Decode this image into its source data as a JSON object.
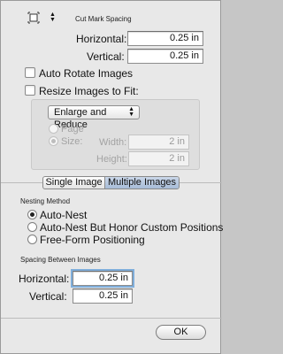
{
  "cut_mark": {
    "title": "Cut Mark Spacing",
    "icon": "crop-marks-icon",
    "horizontal_label": "Horizontal:",
    "horizontal_value": "0.25 in",
    "vertical_label": "Vertical:",
    "vertical_value": "0.25 in"
  },
  "options": {
    "auto_rotate_label": "Auto Rotate Images",
    "resize_label": "Resize Images to Fit:"
  },
  "resize": {
    "mode_value": "Enlarge and Reduce",
    "page_label": "Page",
    "size_label": "Size:",
    "width_label": "Width:",
    "width_value": "2 in",
    "height_label": "Height:",
    "height_value": "2 in"
  },
  "tabs": {
    "single": "Single Image",
    "multiple": "Multiple Images"
  },
  "nesting": {
    "title": "Nesting Method",
    "auto_nest": "Auto-Nest",
    "auto_nest_honor": "Auto-Nest But Honor Custom Positions",
    "free_form": "Free-Form Positioning"
  },
  "spacing": {
    "title": "Spacing Between Images",
    "horizontal_label": "Horizontal:",
    "horizontal_value": "0.25 in",
    "vertical_label": "Vertical:",
    "vertical_value": "0.25 in"
  },
  "footer": {
    "ok_label": "OK"
  }
}
